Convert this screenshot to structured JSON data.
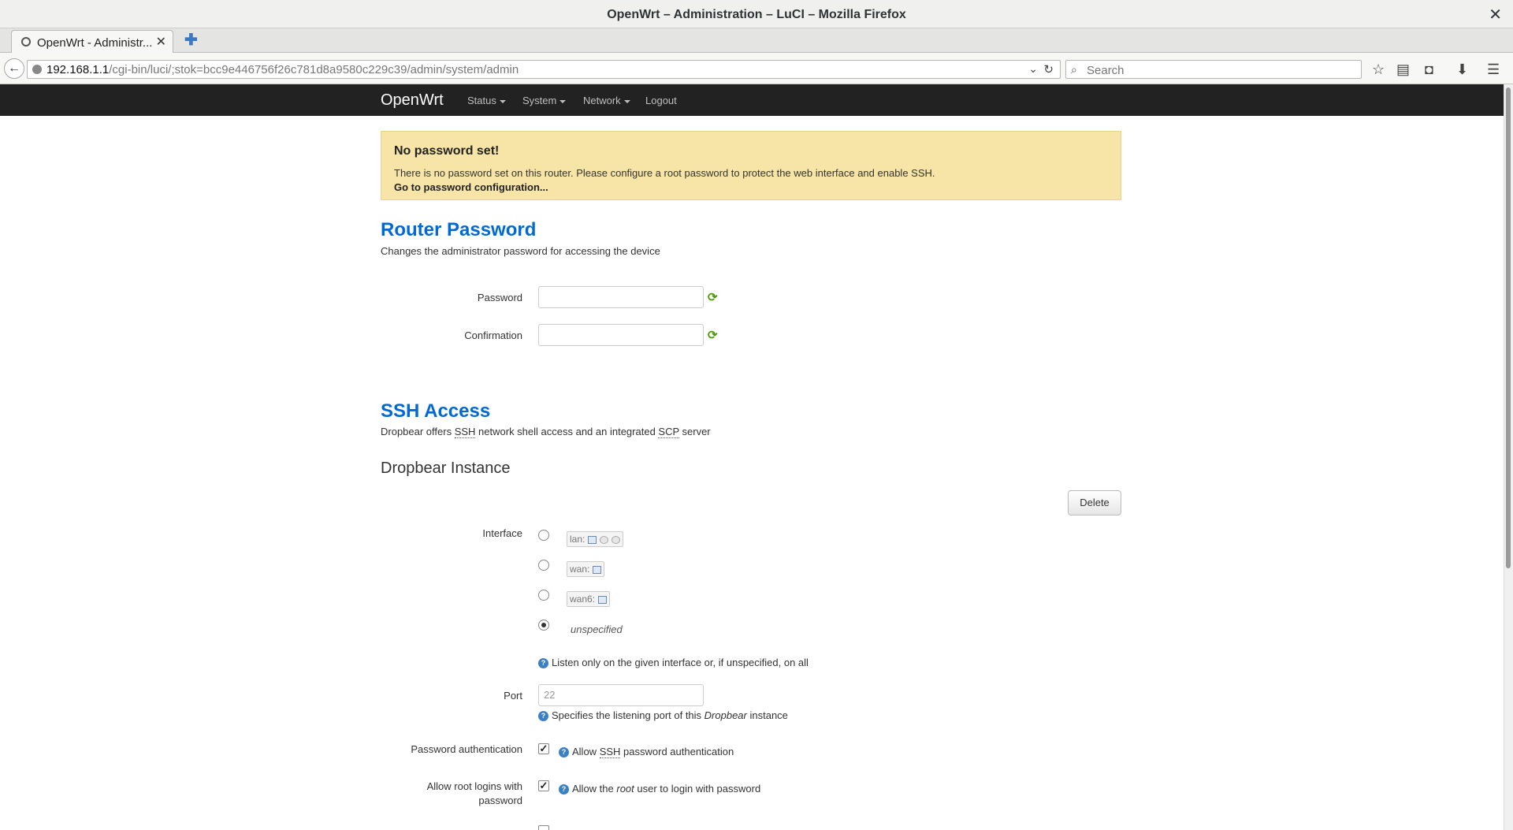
{
  "window": {
    "title": "OpenWrt – Administration – LuCI – Mozilla Firefox"
  },
  "tab": {
    "label": "OpenWrt - Administr..."
  },
  "url": {
    "host": "192.168.1.1",
    "path": "/cgi-bin/luci/;stok=bcc9e446756f26c781d8a9580c229c39/admin/system/admin"
  },
  "search": {
    "placeholder": "Search"
  },
  "nav": {
    "brand": "OpenWrt",
    "items": [
      {
        "label": "Status"
      },
      {
        "label": "System"
      },
      {
        "label": "Network"
      },
      {
        "label": "Logout"
      }
    ]
  },
  "alert": {
    "heading": "No password set!",
    "text": "There is no password set on this router. Please configure a root password to protect the web interface and enable SSH.",
    "link": "Go to password configuration..."
  },
  "router_password": {
    "title": "Router Password",
    "description": "Changes the administrator password for accessing the device",
    "password_label": "Password",
    "confirmation_label": "Confirmation"
  },
  "ssh": {
    "title": "SSH Access",
    "desc_pre": "Dropbear offers ",
    "desc_abbr1": "SSH",
    "desc_mid": " network shell access and an integrated ",
    "desc_abbr2": "SCP",
    "desc_post": " server",
    "instance_title": "Dropbear Instance",
    "delete_label": "Delete",
    "interface_label": "Interface",
    "interfaces": [
      {
        "label": "lan:"
      },
      {
        "label": "wan:"
      },
      {
        "label": "wan6:"
      }
    ],
    "unspecified_label": "unspecified",
    "interface_help": "Listen only on the given interface or, if unspecified, on all",
    "port_label": "Port",
    "port_placeholder": "22",
    "port_help_pre": "Specifies the listening port of this ",
    "port_help_em": "Dropbear",
    "port_help_post": " instance",
    "pw_auth_label": "Password authentication",
    "pw_auth_help_pre": "Allow ",
    "pw_auth_help_abbr": "SSH",
    "pw_auth_help_post": " password authentication",
    "root_label_1": "Allow root logins with",
    "root_label_2": "password",
    "root_help_pre": "Allow the ",
    "root_help_em": "root",
    "root_help_post": " user to login with password"
  }
}
